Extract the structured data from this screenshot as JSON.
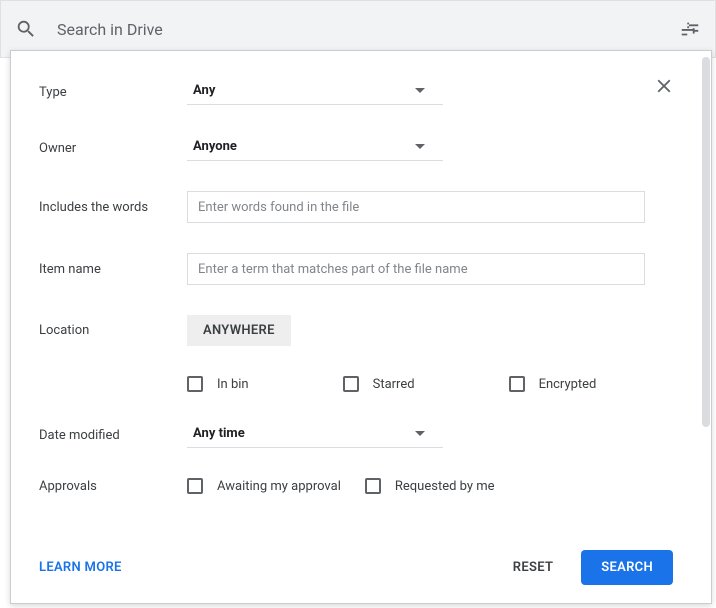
{
  "searchbar": {
    "placeholder": "Search in Drive"
  },
  "filters": {
    "type": {
      "label": "Type",
      "value": "Any"
    },
    "owner": {
      "label": "Owner",
      "value": "Anyone"
    },
    "includes": {
      "label": "Includes the words",
      "placeholder": "Enter words found in the file"
    },
    "item_name": {
      "label": "Item name",
      "placeholder": "Enter a term that matches part of the file name"
    },
    "location": {
      "label": "Location",
      "button": "ANYWHERE"
    },
    "location_flags": {
      "in_bin": "In bin",
      "starred": "Starred",
      "encrypted": "Encrypted"
    },
    "date_modified": {
      "label": "Date modified",
      "value": "Any time"
    },
    "approvals": {
      "label": "Approvals",
      "awaiting": "Awaiting my approval",
      "requested": "Requested by me"
    }
  },
  "footer": {
    "learn_more": "LEARN MORE",
    "reset": "RESET",
    "search": "SEARCH"
  }
}
